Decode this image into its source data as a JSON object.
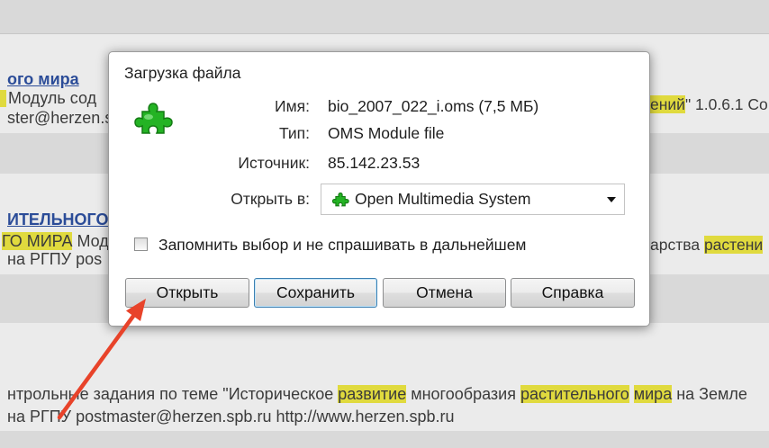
{
  "colors": {
    "link": "#2b4c98",
    "highlight": "#e0da3e",
    "annotation_arrow": "#e8432a",
    "icon_green": "#24b324",
    "focus_border": "#3c7fb1"
  },
  "page": {
    "result1": {
      "title_link": "ого мира",
      "snippet": "Модуль сод",
      "contact": "ster@herzen.s",
      "right_highlight": "ений",
      "right_text": "\" 1.0.6.1 Со"
    },
    "result2": {
      "title_link": "ИТЕЛЬНОГО",
      "snippet_highlight": "ГО МИРА",
      "snippet_text": " Мод",
      "contact": "на РГПУ pos",
      "right_text": "арства ",
      "right_highlight": "растени"
    },
    "result3": {
      "snippet": [
        "нтрольные задания по теме \"Историческое ",
        "развитие",
        " многообразия ",
        "растительного",
        " ",
        "мира",
        " на Земле"
      ],
      "contact": "на РГПУ postmaster@herzen.spb.ru http://www.herzen.spb.ru"
    }
  },
  "dialog": {
    "title": "Загрузка файла",
    "file_icon": "puzzle-piece-icon",
    "name_label": "Имя:",
    "name_value": "bio_2007_022_i.oms (7,5 МБ)",
    "type_label": "Тип:",
    "type_value": "OMS Module file",
    "source_label": "Источник:",
    "source_value": "85.142.23.53",
    "open_with_label": "Открыть в:",
    "open_with": {
      "selected": "Open Multimedia System",
      "icon": "puzzle-piece-icon"
    },
    "remember_choice": {
      "label": "Запомнить выбор и не спрашивать в дальнейшем",
      "checked": false
    },
    "buttons": {
      "open": "Открыть",
      "save": "Сохранить",
      "cancel": "Отмена",
      "help": "Справка"
    }
  }
}
